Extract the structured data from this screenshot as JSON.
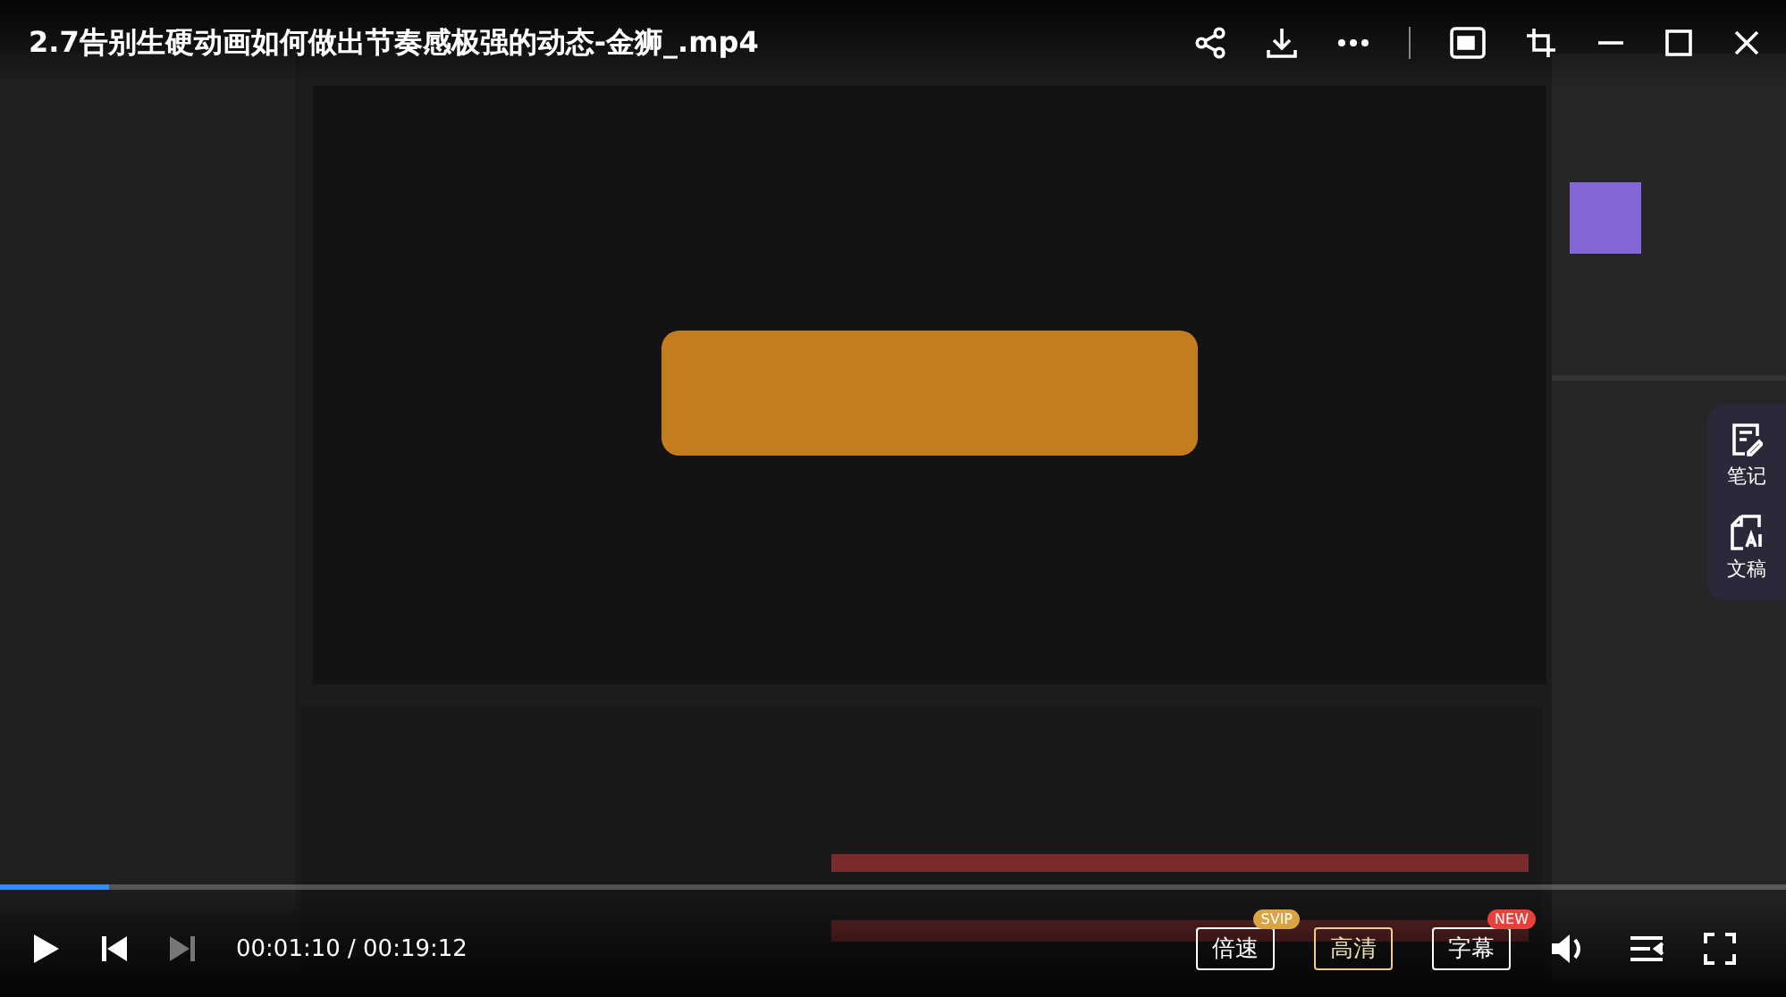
{
  "title": "2.7告别生硬动画如何做出节奏感极强的动态-金狮_.mp4",
  "side_panel": [
    {
      "kind": "notes",
      "label": "笔记"
    },
    {
      "kind": "transcript",
      "label": "文稿"
    }
  ],
  "progress": {
    "level": 0.061
  },
  "time": "00:01:10 / 00:19:12",
  "options": [
    {
      "label": "倍速",
      "selected": false,
      "badge": {
        "text": "SVIP",
        "color": "#d9a441"
      }
    },
    {
      "label": "高清",
      "selected": true
    },
    {
      "label": "字幕",
      "selected": false,
      "badge": {
        "text": "NEW",
        "color": "#e8413c"
      }
    }
  ]
}
